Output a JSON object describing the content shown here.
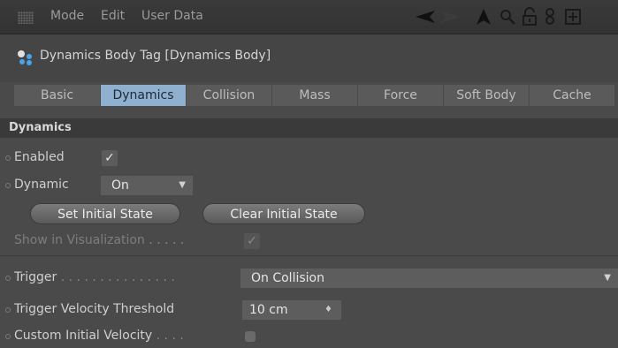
{
  "menu": {
    "mode": "Mode",
    "edit": "Edit",
    "user_data": "User Data"
  },
  "tag": {
    "title": "Dynamics Body Tag [Dynamics Body]"
  },
  "tabs": [
    "Basic",
    "Dynamics",
    "Collision",
    "Mass",
    "Force",
    "Soft Body",
    "Cache"
  ],
  "active_tab": "Dynamics",
  "section": {
    "title": "Dynamics"
  },
  "fields": {
    "enabled_label": "Enabled",
    "enabled_value": "✓",
    "dynamic_label": "Dynamic",
    "dynamic_value": "On",
    "set_initial_state": "Set Initial State",
    "clear_initial_state": "Clear Initial State",
    "show_in_visualization": "Show in Visualization",
    "show_dots": " . . . . .",
    "show_check": "✓",
    "trigger_label": "Trigger",
    "trigger_dots": " . . . . . . . . . . . . . . .",
    "trigger_value": "On Collision",
    "trigger_velocity_label": "Trigger Velocity Threshold",
    "trigger_velocity_value": "10 cm",
    "custom_initial_velocity_label": "Custom Initial Velocity",
    "custom_initial_velocity_dots": " . . . ."
  },
  "colors": {
    "accent_tab": "#8fb0cf",
    "panel": "#4a4a4a"
  },
  "icons": [
    "grip-icon",
    "arrow-left-icon",
    "cursor-icon",
    "search-icon",
    "lock-icon",
    "link-icon",
    "new-window-icon",
    "dynamics-tag-icon"
  ]
}
